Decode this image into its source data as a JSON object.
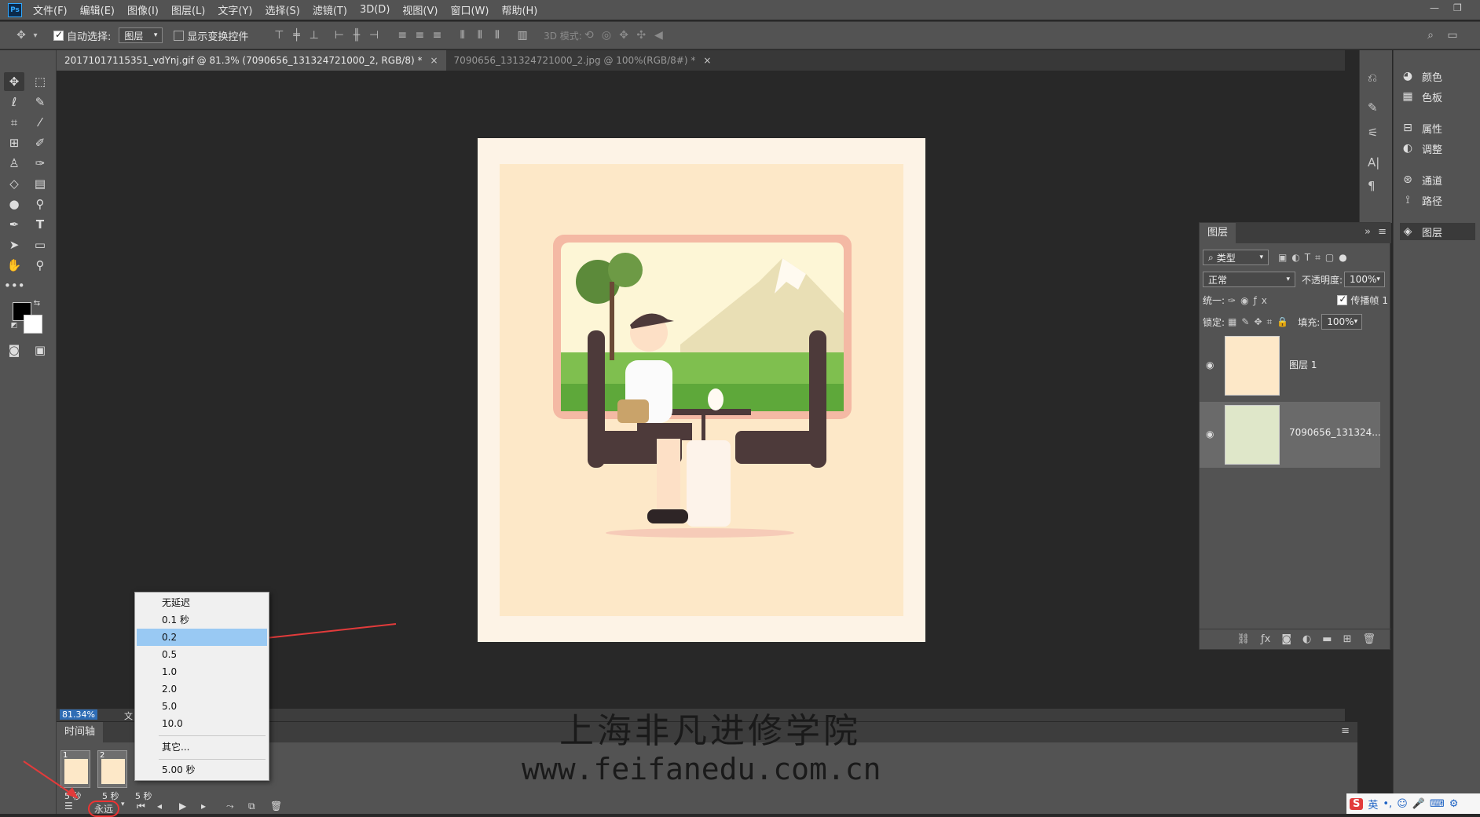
{
  "app": {
    "logo": "Ps"
  },
  "menu": [
    "文件(F)",
    "编辑(E)",
    "图像(I)",
    "图层(L)",
    "文字(Y)",
    "选择(S)",
    "滤镜(T)",
    "3D(D)",
    "视图(V)",
    "窗口(W)",
    "帮助(H)"
  ],
  "options": {
    "auto_select_label": "自动选择:",
    "auto_select_value": "图层",
    "show_transform_label": "显示变换控件",
    "mode_3d_label": "3D 模式:"
  },
  "tabs": [
    {
      "label": "20171017115351_vdYnj.gif @ 81.3% (7090656_131324721000_2, RGB/8) *",
      "close": "×"
    },
    {
      "label": "7090656_131324721000_2.jpg @ 100%(RGB/8#) *",
      "close": "×"
    }
  ],
  "status": {
    "zoom": "81.34%",
    "doc": "文"
  },
  "timeline": {
    "tab": "时间轴",
    "frames": [
      {
        "num": "1",
        "delay": "5 秒"
      },
      {
        "num": "2",
        "delay": "5 秒"
      },
      {
        "num": "",
        "delay": "5 秒"
      }
    ],
    "loop": "永远"
  },
  "delay_menu": {
    "items": [
      "无延迟",
      "0.1 秒",
      "0.2",
      "0.5",
      "1.0",
      "2.0",
      "5.0",
      "10.0"
    ],
    "selected": "0.2",
    "other": "其它...",
    "current": "5.00 秒"
  },
  "right_panel": {
    "items": [
      {
        "icon": "palette-icon",
        "label": "颜色"
      },
      {
        "icon": "grid-icon",
        "label": "色板"
      },
      {
        "icon": "properties-icon",
        "label": "属性"
      },
      {
        "icon": "adjust-icon",
        "label": "调整"
      },
      {
        "icon": "channels-icon",
        "label": "通道"
      },
      {
        "icon": "paths-icon",
        "label": "路径"
      },
      {
        "icon": "layers-icon",
        "label": "图层"
      }
    ]
  },
  "layers_panel": {
    "tab": "图层",
    "filter": "类型",
    "blend": "正常",
    "opacity_label": "不透明度:",
    "opacity": "100%",
    "unify_label": "统一:",
    "propagate_label": "传播帧",
    "propagate_value": "1",
    "lock_label": "锁定:",
    "fill_label": "填充:",
    "fill": "100%",
    "layers": [
      {
        "name": "图层 1"
      },
      {
        "name": "7090656_131324..."
      }
    ]
  },
  "watermark": {
    "line1": "上海非凡进修学院",
    "line2": "www.feifanedu.com.cn"
  },
  "ime": {
    "logo": "S",
    "lang": "英"
  }
}
